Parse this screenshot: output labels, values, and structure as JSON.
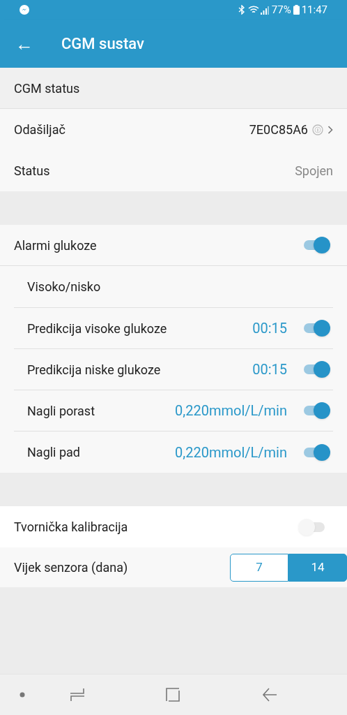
{
  "status_bar": {
    "battery": "77%",
    "time": "11:47"
  },
  "app_bar": {
    "back": "←",
    "title": "CGM sustav"
  },
  "section_header": "CGM status",
  "device_rows": [
    {
      "kind": "link",
      "label": "Odašiljač",
      "value": "7E0C85A6"
    },
    {
      "kind": "text",
      "label": "Status",
      "value": "Spojen"
    }
  ],
  "alarms": {
    "label": "Alarmi glukoze",
    "on": true,
    "subheader": "Visoko/nisko",
    "items": [
      {
        "label": "Predikcija visoke glukoze",
        "value": "00:15",
        "on": true
      },
      {
        "label": "Predikcija niske glukoze",
        "value": "00:15",
        "on": true
      },
      {
        "label": "Nagli porast",
        "value": "0,220mmol/L/min",
        "on": true
      },
      {
        "label": "Nagli pad",
        "value": "0,220mmol/L/min",
        "on": true
      }
    ]
  },
  "factory_calibration": {
    "label": "Tvornička kalibracija",
    "on": false
  },
  "sensor_life": {
    "label": "Vijek senzora (dana)",
    "options": [
      {
        "label": "7",
        "selected": false
      },
      {
        "label": "14",
        "selected": true
      }
    ]
  }
}
